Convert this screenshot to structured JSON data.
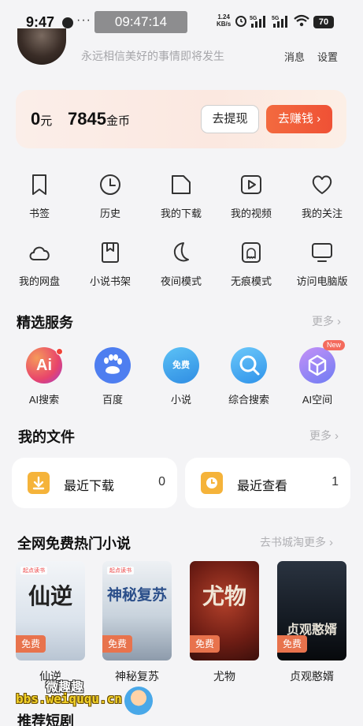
{
  "status_bar": {
    "time": "9:47",
    "dots": "···",
    "clock_chip": "09:47:14",
    "net_speed_value": "1.24",
    "net_speed_unit": "KB/s",
    "signal_labels": [
      "5G",
      "5G"
    ],
    "battery": "70"
  },
  "header": {
    "motto": "永远相信美好的事情即将发生",
    "messages": "消息",
    "settings": "设置"
  },
  "wallet": {
    "cash_value": "0",
    "cash_unit": "元",
    "coins_value": "7845",
    "coins_unit": "金币",
    "withdraw_label": "去提现",
    "earn_label": "去赚钱",
    "earn_chevron": "›"
  },
  "quick_grid": [
    {
      "label": "书签",
      "icon": "bookmark-icon"
    },
    {
      "label": "历史",
      "icon": "clock-icon"
    },
    {
      "label": "我的下载",
      "icon": "folder-icon"
    },
    {
      "label": "我的视频",
      "icon": "video-icon"
    },
    {
      "label": "我的关注",
      "icon": "heart-icon"
    },
    {
      "label": "我的网盘",
      "icon": "cloud-icon"
    },
    {
      "label": "小说书架",
      "icon": "book-icon"
    },
    {
      "label": "夜间模式",
      "icon": "moon-icon"
    },
    {
      "label": "无痕模式",
      "icon": "ghost-icon"
    },
    {
      "label": "访问电脑版",
      "icon": "monitor-icon"
    }
  ],
  "services": {
    "title": "精选服务",
    "more": "更多",
    "items": [
      {
        "label": "AI搜索",
        "icon_text": "Ai",
        "color": "#e8456b",
        "badge": "dot"
      },
      {
        "label": "百度",
        "icon_text": "",
        "color": "#4e7ef0",
        "badge": ""
      },
      {
        "label": "小说",
        "icon_text": "免费",
        "color": "#3fa2ec",
        "badge": ""
      },
      {
        "label": "综合搜索",
        "icon_text": "",
        "color": "#46b0f3",
        "badge": ""
      },
      {
        "label": "AI空间",
        "icon_text": "",
        "color": "#9b7cf3",
        "badge": "New"
      }
    ]
  },
  "files": {
    "title": "我的文件",
    "more": "更多",
    "items": [
      {
        "label": "最近下载",
        "count": "0",
        "icon": "download-icon"
      },
      {
        "label": "最近查看",
        "count": "1",
        "icon": "recent-icon"
      }
    ]
  },
  "novels": {
    "title": "全网免费热门小说",
    "more": "去书城淘更多",
    "free_tag": "免费",
    "brand": "起点读书",
    "books": [
      {
        "name": "仙逆",
        "cover_title": "仙逆"
      },
      {
        "name": "神秘复苏",
        "cover_title": "神秘复苏"
      },
      {
        "name": "尤物",
        "cover_title": "尤物"
      },
      {
        "name": "贞观憨婿",
        "cover_title": "贞观憨婿"
      }
    ]
  },
  "bottom": {
    "watermark_url": "bbs.weiququ.cn",
    "watermark_cn": "微趣趣",
    "short_drama_title": "推荐短剧"
  },
  "colors": {
    "accent_orange": "#ef5135",
    "free_tag": "#e8734d",
    "muted_text": "#b0b0b4"
  }
}
